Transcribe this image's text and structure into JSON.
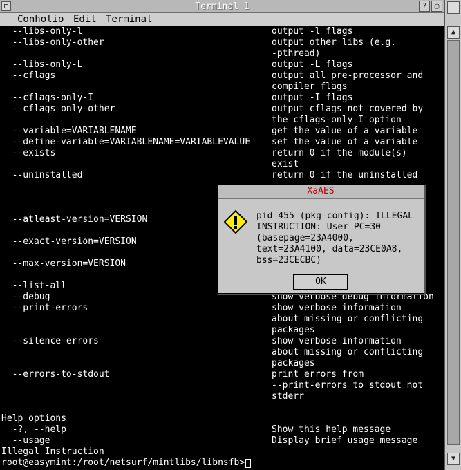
{
  "window": {
    "title": "Terminal 1",
    "titlebar_buttons": [
      "?",
      "▢"
    ],
    "colors": {
      "titlebar": "#b8b8b8",
      "terminal_bg": "#000000",
      "terminal_fg": "#ffffff",
      "dialog_bg": "#c8c8c8",
      "dialog_title": "#c00000"
    }
  },
  "menubar": {
    "items": [
      "Conholio",
      "Edit",
      "Terminal"
    ]
  },
  "terminal": {
    "lines": [
      {
        "l": "  --libs-only-l",
        "r": "output -l flags"
      },
      {
        "l": "  --libs-only-other",
        "r": "output other libs (e.g."
      },
      {
        "l": "",
        "r": "-pthread)"
      },
      {
        "l": "  --libs-only-L",
        "r": "output -L flags"
      },
      {
        "l": "  --cflags",
        "r": "output all pre-processor and"
      },
      {
        "l": "",
        "r": "compiler flags"
      },
      {
        "l": "  --cflags-only-I",
        "r": "output -I flags"
      },
      {
        "l": "  --cflags-only-other",
        "r": "output cflags not covered by"
      },
      {
        "l": "",
        "r": "the cflags-only-I option"
      },
      {
        "l": "  --variable=VARIABLENAME",
        "r": "get the value of a variable"
      },
      {
        "l": "  --define-variable=VARIABLENAME=VARIABLEVALUE",
        "r": "set the value of a variable"
      },
      {
        "l": "  --exists",
        "r": "return 0 if the module(s)"
      },
      {
        "l": "",
        "r": "exist"
      },
      {
        "l": "  --uninstalled",
        "r": "return 0 if the uninstalled"
      },
      {
        "l": "",
        "r": ""
      },
      {
        "l": "",
        "r": ""
      },
      {
        "l": "",
        "r": ""
      },
      {
        "l": "  --atleast-version=VERSION",
        "r": ""
      },
      {
        "l": "",
        "r": ""
      },
      {
        "l": "  --exact-version=VERSION",
        "r": ""
      },
      {
        "l": "",
        "r": ""
      },
      {
        "l": "  --max-version=VERSION",
        "r": ""
      },
      {
        "l": "",
        "r": ""
      },
      {
        "l": "  --list-all",
        "r": ""
      },
      {
        "l": "  --debug",
        "r": "show verbose debug information"
      },
      {
        "l": "  --print-errors",
        "r": "show verbose information"
      },
      {
        "l": "",
        "r": "about missing or conflicting"
      },
      {
        "l": "",
        "r": "packages"
      },
      {
        "l": "  --silence-errors",
        "r": "show verbose information"
      },
      {
        "l": "",
        "r": "about missing or conflicting"
      },
      {
        "l": "",
        "r": "packages"
      },
      {
        "l": "  --errors-to-stdout",
        "r": "print errors from"
      },
      {
        "l": "",
        "r": "--print-errors to stdout not"
      },
      {
        "l": "",
        "r": "stderr"
      },
      {
        "l": "",
        "r": ""
      },
      {
        "l": "Help options",
        "r": ""
      },
      {
        "l": "  -?, --help",
        "r": "Show this help message"
      },
      {
        "l": "  --usage",
        "r": "Display brief usage message"
      },
      {
        "l": "Illegal Instruction",
        "r": ""
      },
      {
        "l": "root@easymint:/root/netsurf/mintlibs/libnsfb>",
        "r": ""
      }
    ]
  },
  "dialog": {
    "title": "XaAES",
    "icon": "warning-icon",
    "message": "pid 455 (pkg-config): ILLEGAL\nINSTRUCTION: User PC=30\n(basepage=23A4000,\ntext=23A4100, data=23CE0A8,\nbss=23CECBC)",
    "ok_label": "OK"
  },
  "scrollbar": {
    "up_icon": "▲",
    "down_icon": "▼"
  }
}
